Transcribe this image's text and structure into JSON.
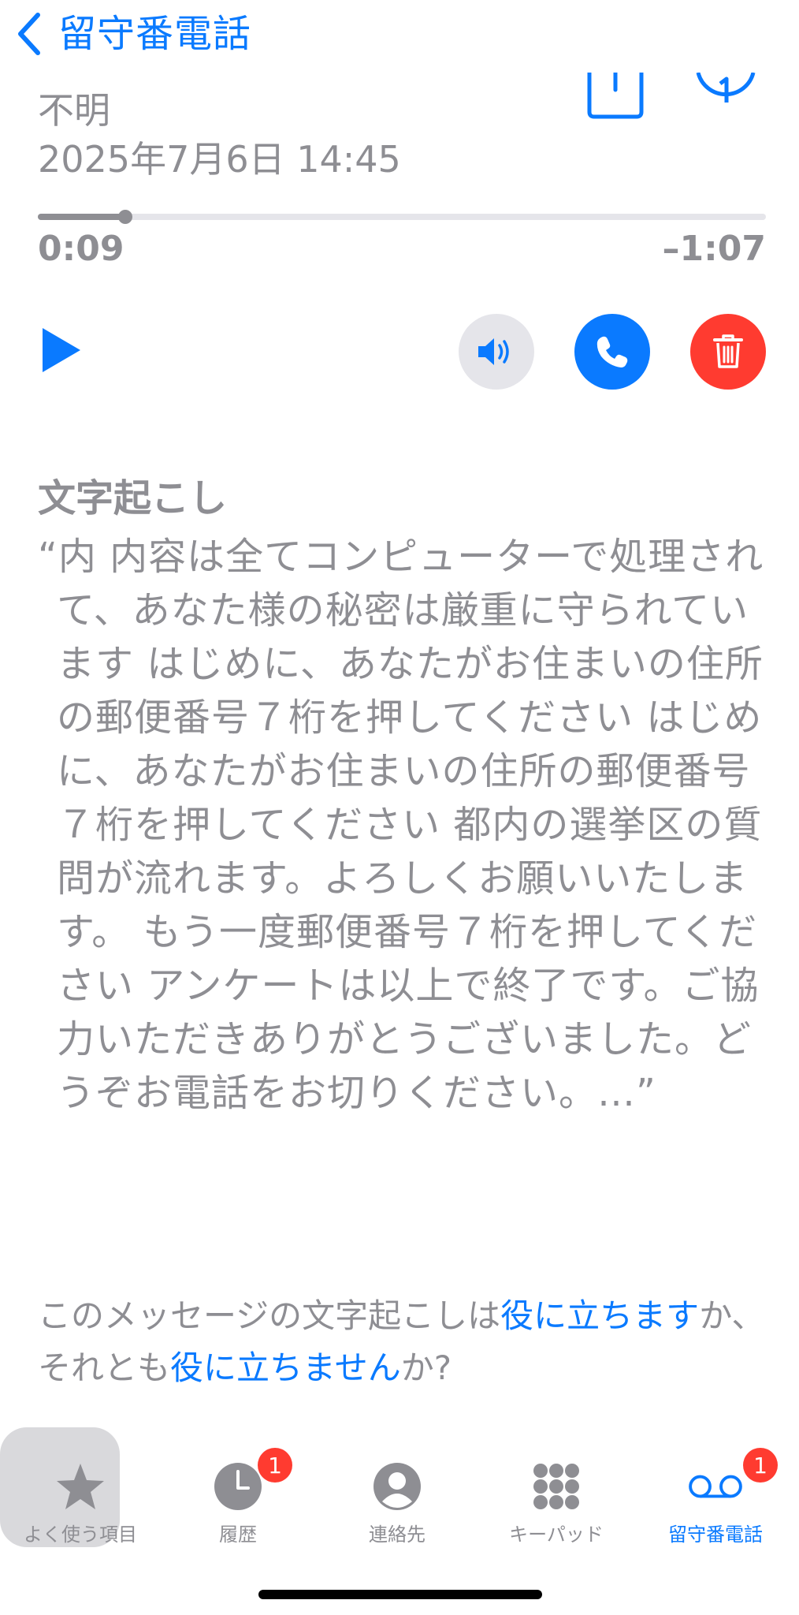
{
  "header": {
    "back_label": "留守番電話"
  },
  "message": {
    "caller": "不明",
    "datetime": "2025年7月6日 14:45"
  },
  "player": {
    "elapsed": "0:09",
    "remaining": "–1:07",
    "progress": 0.12
  },
  "transcript": {
    "title": "文字起こし",
    "text": "“内 内容は全てコンピューターで処理されて、あなた様の秘密は厳重に守られています はじめに、あなたがお住まいの住所の郵便番号７桁を押してください はじめに、あなたがお住まいの住所の郵便番号７桁を押してください 都内の選挙区の質問が流れます。よろしくお願いいたします。 もう一度郵便番号７桁を押してください アンケートは以上で終了です。ご協力いただきありがとうございました。どうぞお電話をお切りください。…”"
  },
  "feedback": {
    "prefix": "このメッセージの文字起こしは",
    "useful_link": "役に立ちます",
    "middle": "か、それとも",
    "not_useful_link": "役に立ちません",
    "suffix": "か?"
  },
  "tabs": [
    {
      "label": "よく使う項目",
      "icon": "star-icon"
    },
    {
      "label": "履歴",
      "icon": "clock-icon",
      "badge": "1"
    },
    {
      "label": "連絡先",
      "icon": "person-icon"
    },
    {
      "label": "キーパッド",
      "icon": "keypad-icon"
    },
    {
      "label": "留守番電話",
      "icon": "voicemail-icon",
      "badge": "1"
    }
  ],
  "colors": {
    "accent": "#0a7aff",
    "danger": "#ff3b30",
    "secondary_text": "#8e8e93"
  }
}
